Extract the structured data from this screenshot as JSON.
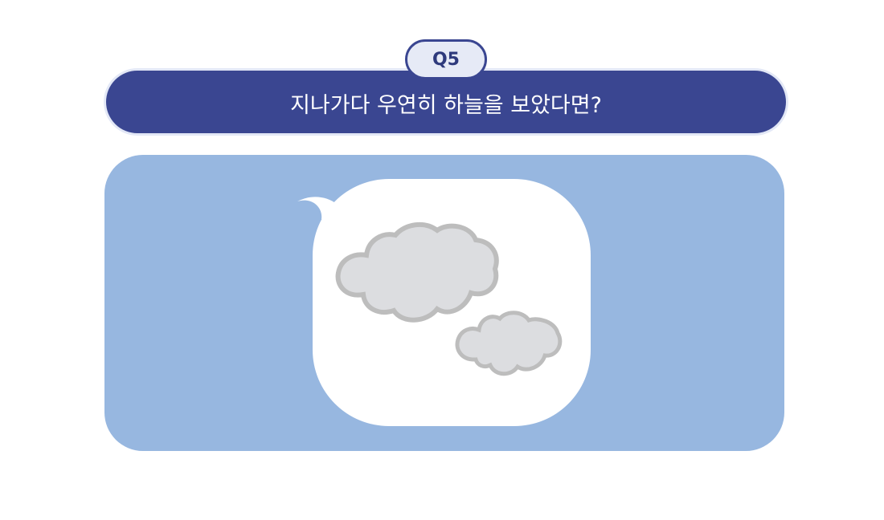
{
  "badge": {
    "label": "Q5"
  },
  "question": {
    "text": "지나가다 우연히 하늘을 보았다면?"
  },
  "illustration": {
    "icon": "cloud-icon",
    "colors": {
      "banner": "#3a4691",
      "badge_fill": "#e6eaf6",
      "panel": "#97b7e0",
      "bubble": "#ffffff",
      "cloud_fill": "#dcdde0",
      "cloud_stroke": "#bdbdbd"
    }
  }
}
